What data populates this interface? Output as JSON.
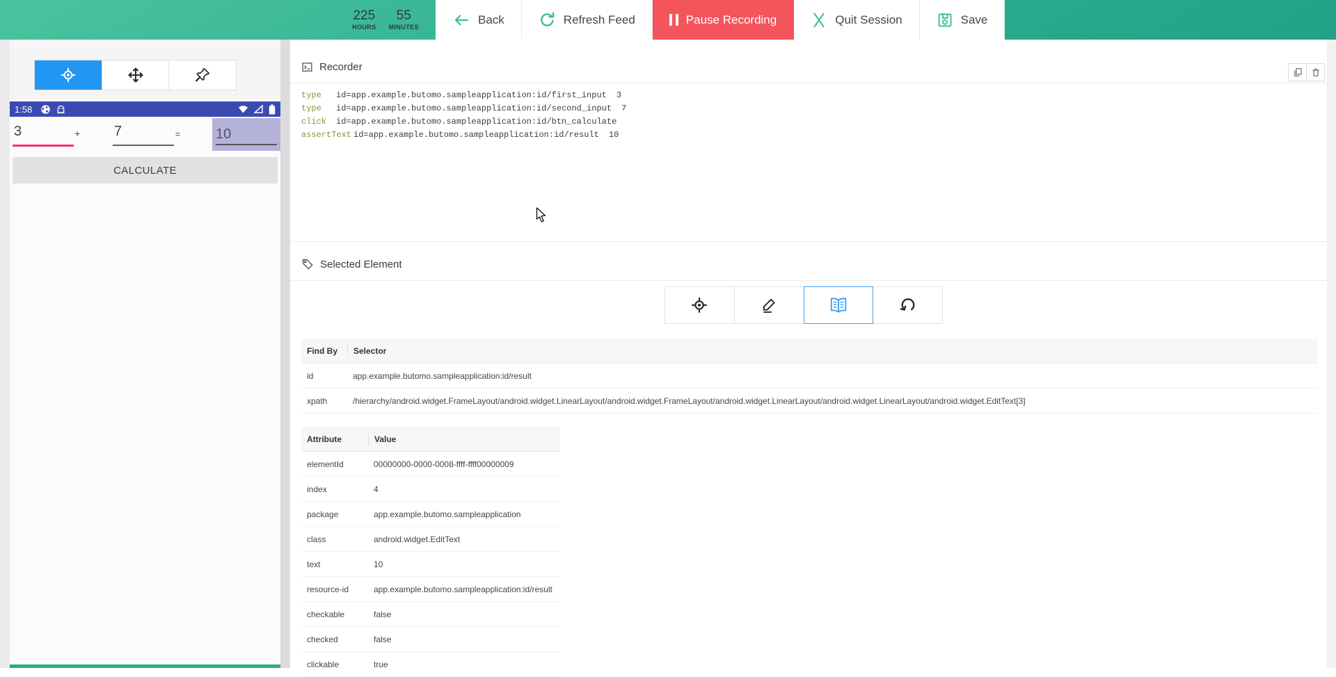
{
  "topbar": {
    "timer": {
      "hours_value": "225",
      "hours_unit": "HOURS",
      "minutes_value": "55",
      "minutes_unit": "MINUTES"
    },
    "back_label": "Back",
    "refresh_label": "Refresh Feed",
    "pause_label": "Pause Recording",
    "quit_label": "Quit Session",
    "save_label": "Save"
  },
  "device_mirror": {
    "status_bar_time": "1:58",
    "calculator": {
      "first_input": "3",
      "operator": "+",
      "second_input": "7",
      "equals": "=",
      "result": "10",
      "calculate_label": "CALCULATE"
    }
  },
  "recorder": {
    "title": "Recorder",
    "lines": [
      {
        "command": "type",
        "selector": "id=app.example.butomo.sampleapplication:id/first_input",
        "value": "3"
      },
      {
        "command": "type",
        "selector": "id=app.example.butomo.sampleapplication:id/second_input",
        "value": "7"
      },
      {
        "command": "click",
        "selector": "id=app.example.butomo.sampleapplication:id/btn_calculate",
        "value": ""
      },
      {
        "command": "assertText",
        "selector": "id=app.example.butomo.sampleapplication:id/result",
        "value": "10"
      }
    ]
  },
  "selected_element": {
    "title": "Selected Element",
    "find_by": {
      "headers": [
        "Find By",
        "Selector"
      ],
      "rows": [
        [
          "id",
          "app.example.butomo.sampleapplication:id/result"
        ],
        [
          "xpath",
          "/hierarchy/android.widget.FrameLayout/android.widget.LinearLayout/android.widget.FrameLayout/android.widget.LinearLayout/android.widget.LinearLayout/android.widget.EditText[3]"
        ]
      ]
    },
    "attributes": {
      "headers": [
        "Attribute",
        "Value"
      ],
      "rows": [
        [
          "elementId",
          "00000000-0000-0008-ffff-ffff00000009"
        ],
        [
          "index",
          "4"
        ],
        [
          "package",
          "app.example.butomo.sampleapplication"
        ],
        [
          "class",
          "android.widget.EditText"
        ],
        [
          "text",
          "10"
        ],
        [
          "resource-id",
          "app.example.butomo.sampleapplication:id/result"
        ],
        [
          "checkable",
          "false"
        ],
        [
          "checked",
          "false"
        ],
        [
          "clickable",
          "true"
        ]
      ]
    }
  },
  "icons": {
    "back": "arrow-left",
    "refresh_feed": "refresh-circular-arrow",
    "pause": "pause-bars",
    "quit": "x-mark",
    "save": "floppy-disk",
    "recorder_panel": "terminal-window",
    "copy": "copy-pages",
    "delete": "trash-can",
    "selected_element_panel": "tag",
    "mirror_tools": [
      "locate-target",
      "move-arrows",
      "pin"
    ],
    "inspect_tools": [
      "locate-target",
      "edit-pencil",
      "book-open",
      "refresh-loop"
    ],
    "status_bar": [
      "sync",
      "ghost",
      "wifi",
      "cell-signal",
      "battery"
    ],
    "pointer": "mouse-cursor"
  },
  "colors": {
    "topbar_teal_start": "#4ac49f",
    "topbar_teal_end": "#21a388",
    "record_red": "#f4545c",
    "accent_blue": "#2196f3",
    "android_statusbar_indigo": "#3b4ab1",
    "focused_underline_pink": "#f5326e",
    "selection_lavender": "#b5b2da",
    "command_green": "#7d9a3c",
    "icon_green": "#3cbc97"
  }
}
